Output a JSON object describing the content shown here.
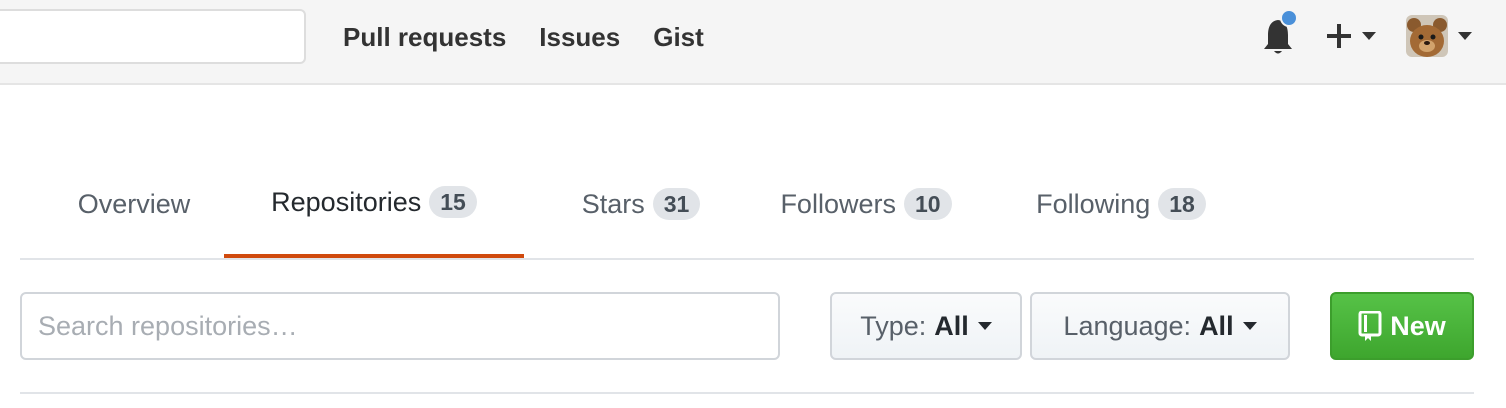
{
  "header": {
    "search": {
      "value": "",
      "placeholder": ""
    },
    "nav": [
      "Pull requests",
      "Issues",
      "Gist"
    ],
    "icons": {
      "notifications": "bell-icon",
      "create": "plus-icon",
      "avatar": "user-avatar"
    },
    "notification_dot_color": "#4a90d9"
  },
  "tabs": [
    {
      "label": "Overview",
      "count": null,
      "selected": false
    },
    {
      "label": "Repositories",
      "count": "15",
      "selected": true
    },
    {
      "label": "Stars",
      "count": "31",
      "selected": false
    },
    {
      "label": "Followers",
      "count": "10",
      "selected": false
    },
    {
      "label": "Following",
      "count": "18",
      "selected": false
    }
  ],
  "filters": {
    "search_placeholder": "Search repositories…",
    "type": {
      "label": "Type:",
      "value": "All"
    },
    "language": {
      "label": "Language:",
      "value": "All"
    },
    "new_button": "New"
  },
  "colors": {
    "accent_tab_underline": "#d04a0e",
    "new_button_green": "#4bb13a"
  }
}
